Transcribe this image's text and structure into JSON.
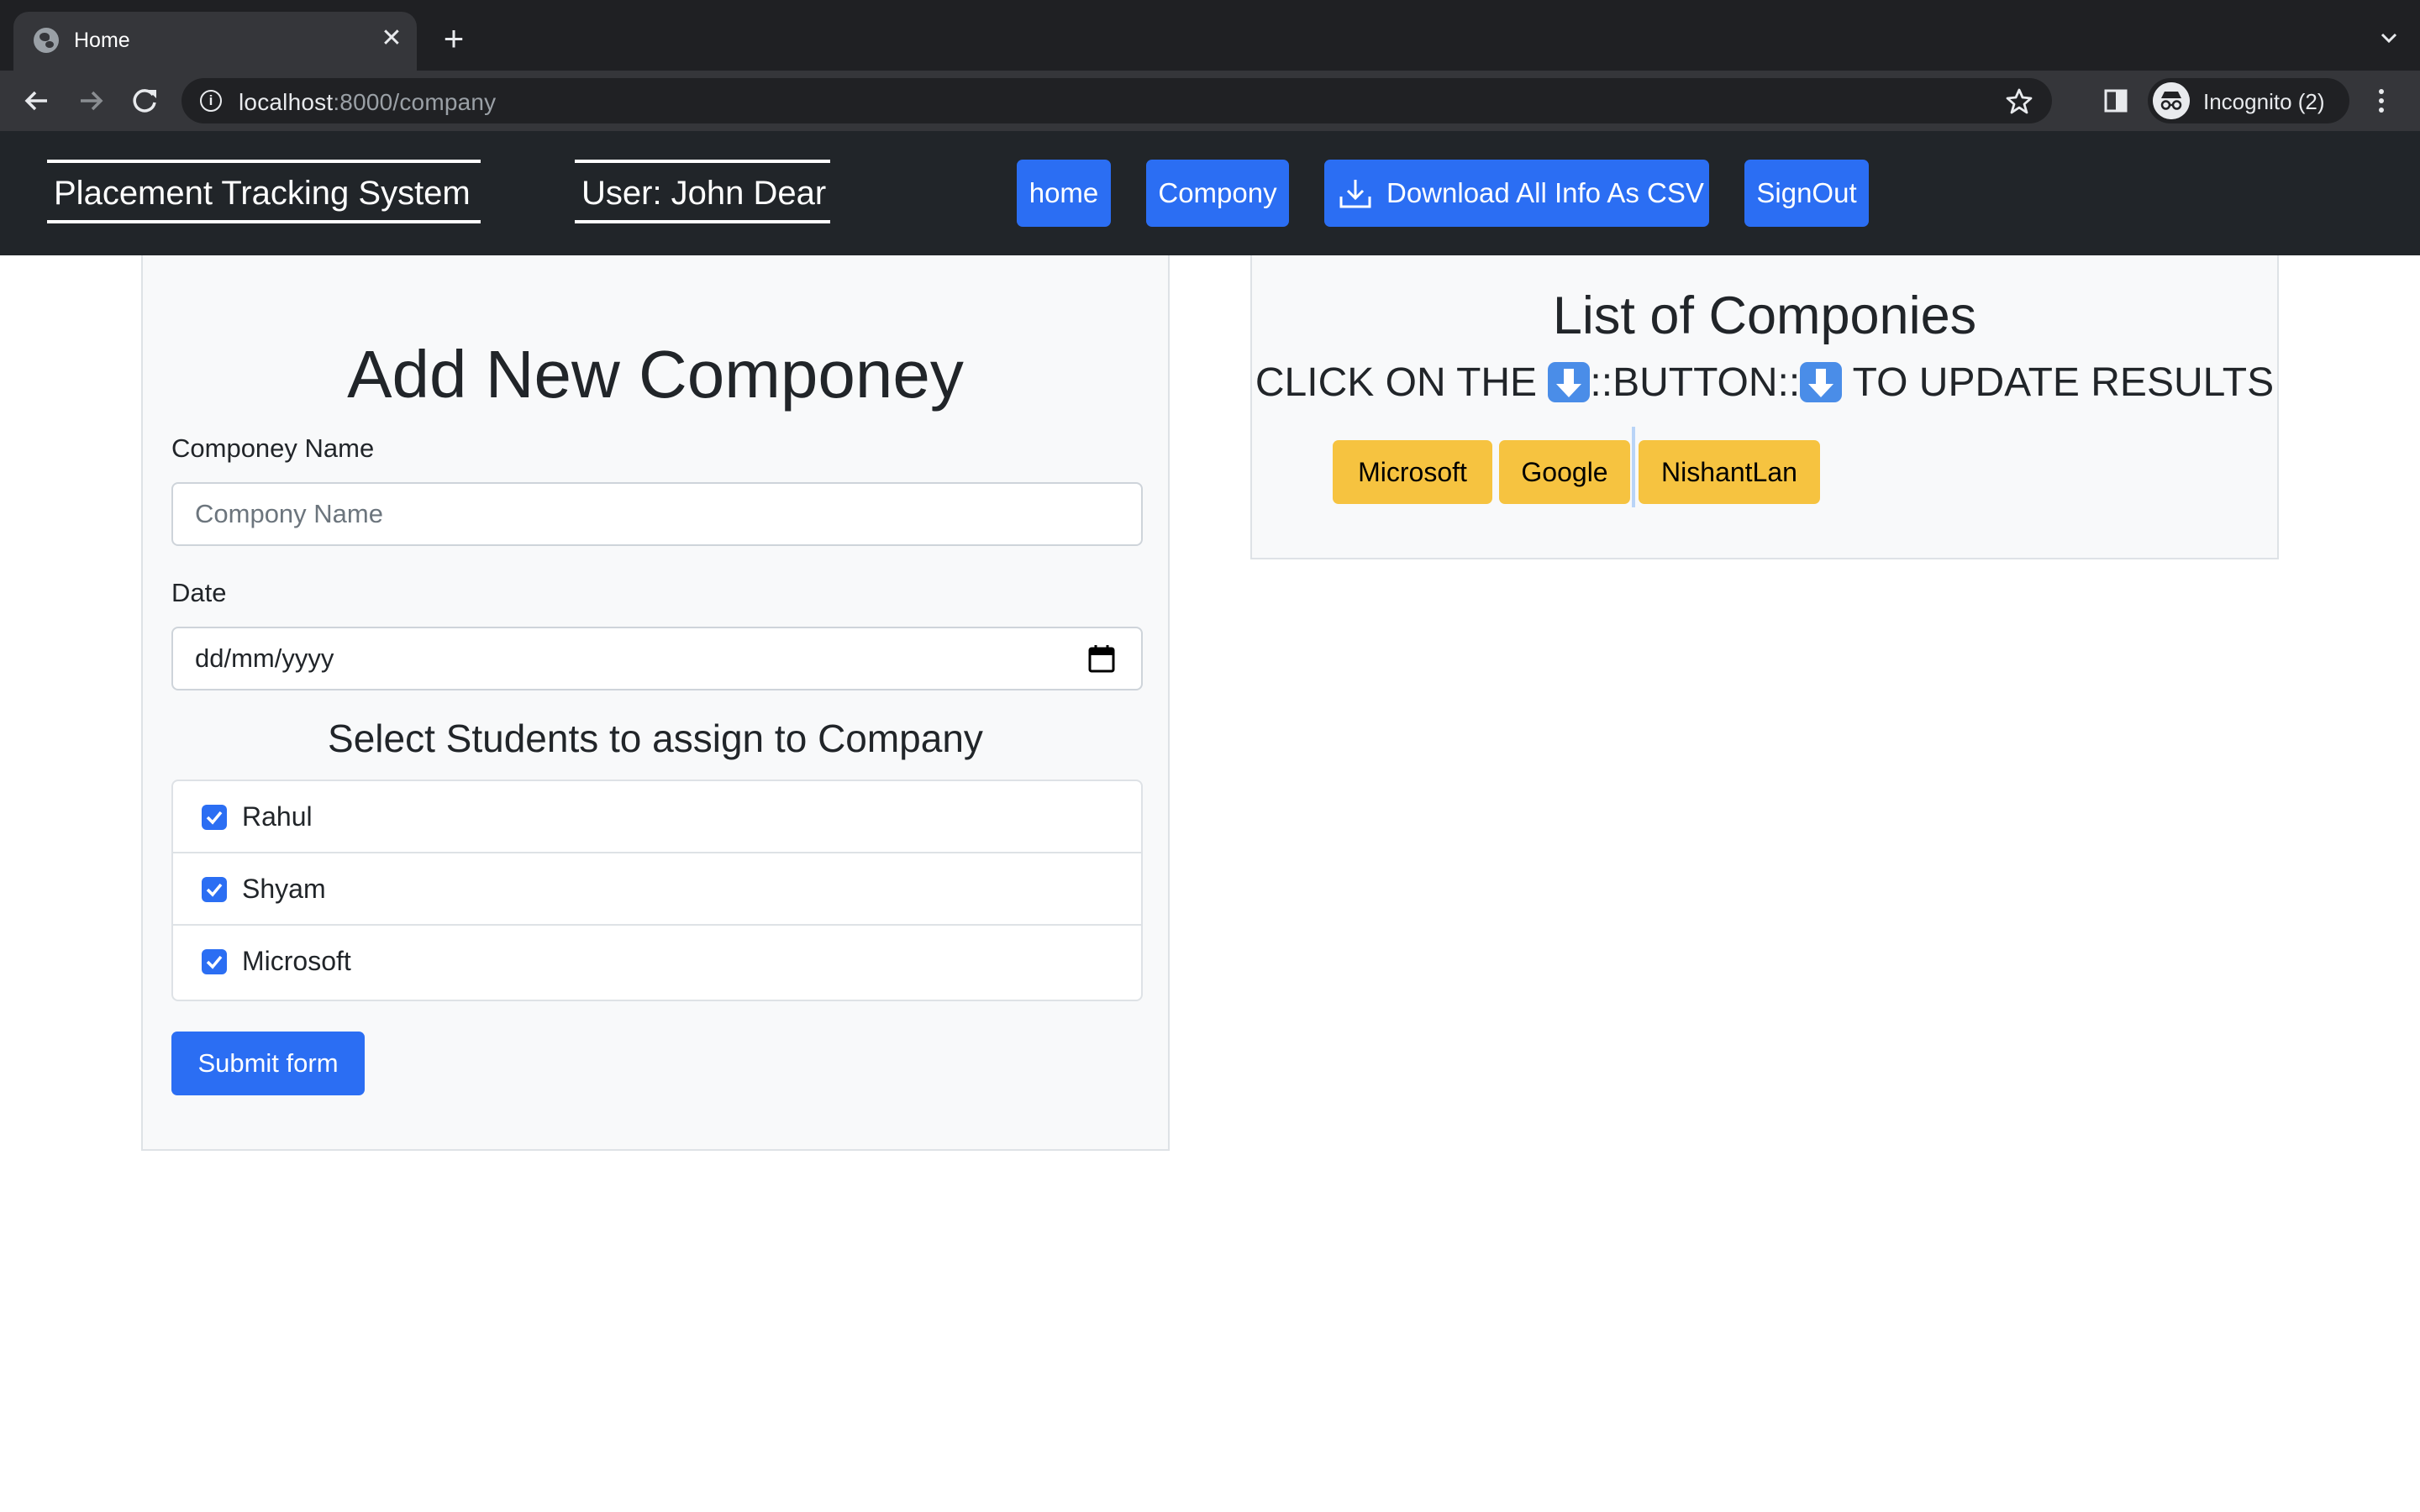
{
  "browser": {
    "tab_title": "Home",
    "tab_close_glyph": "✕",
    "new_tab_glyph": "+",
    "url_host": "localhost",
    "url_rest": ":8000/company",
    "profile_label": "Incognito (2)",
    "icons": [
      "globe-icon",
      "back-icon",
      "forward-icon",
      "reload-icon",
      "info-icon",
      "star-icon",
      "side-panel-icon",
      "incognito-icon",
      "more-icon"
    ]
  },
  "navbar": {
    "brand": "Placement Tracking System",
    "user": "User: John Dear",
    "buttons": {
      "home": "home",
      "company": "Compony",
      "download": "Download All Info As CSV",
      "signout": "SignOut"
    }
  },
  "add_form": {
    "heading": "Add New Componey",
    "name_label": "Componey Name",
    "name_placeholder": "Compony Name",
    "date_label": "Date",
    "date_placeholder": "dd/mm/yyyy",
    "select_heading": "Select Students to assign to Company",
    "students": [
      {
        "name": "Rahul",
        "checked": true
      },
      {
        "name": "Shyam",
        "checked": true
      },
      {
        "name": "Microsoft",
        "checked": true
      }
    ],
    "submit_label": "Submit form"
  },
  "company_list": {
    "heading": "List of Componies",
    "instruction_start": "CLICK ON THE ",
    "instruction_mid": "::BUTTON::",
    "instruction_end": " TO UPDATE RESULTS",
    "companies": [
      "Microsoft",
      "Google",
      "NishantLan"
    ]
  },
  "colors": {
    "primary": "#2b6ef3",
    "warning": "#f6c340",
    "navbar": "#212529",
    "card": "#f8f9fa"
  }
}
